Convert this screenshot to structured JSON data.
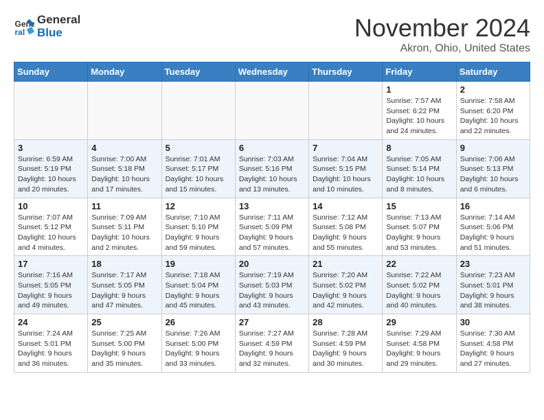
{
  "logo": {
    "line1": "General",
    "line2": "Blue"
  },
  "title": "November 2024",
  "location": "Akron, Ohio, United States",
  "weekdays": [
    "Sunday",
    "Monday",
    "Tuesday",
    "Wednesday",
    "Thursday",
    "Friday",
    "Saturday"
  ],
  "weeks": [
    [
      {
        "day": "",
        "info": ""
      },
      {
        "day": "",
        "info": ""
      },
      {
        "day": "",
        "info": ""
      },
      {
        "day": "",
        "info": ""
      },
      {
        "day": "",
        "info": ""
      },
      {
        "day": "1",
        "info": "Sunrise: 7:57 AM\nSunset: 6:22 PM\nDaylight: 10 hours and 24 minutes."
      },
      {
        "day": "2",
        "info": "Sunrise: 7:58 AM\nSunset: 6:20 PM\nDaylight: 10 hours and 22 minutes."
      }
    ],
    [
      {
        "day": "3",
        "info": "Sunrise: 6:59 AM\nSunset: 5:19 PM\nDaylight: 10 hours and 20 minutes."
      },
      {
        "day": "4",
        "info": "Sunrise: 7:00 AM\nSunset: 5:18 PM\nDaylight: 10 hours and 17 minutes."
      },
      {
        "day": "5",
        "info": "Sunrise: 7:01 AM\nSunset: 5:17 PM\nDaylight: 10 hours and 15 minutes."
      },
      {
        "day": "6",
        "info": "Sunrise: 7:03 AM\nSunset: 5:16 PM\nDaylight: 10 hours and 13 minutes."
      },
      {
        "day": "7",
        "info": "Sunrise: 7:04 AM\nSunset: 5:15 PM\nDaylight: 10 hours and 10 minutes."
      },
      {
        "day": "8",
        "info": "Sunrise: 7:05 AM\nSunset: 5:14 PM\nDaylight: 10 hours and 8 minutes."
      },
      {
        "day": "9",
        "info": "Sunrise: 7:06 AM\nSunset: 5:13 PM\nDaylight: 10 hours and 6 minutes."
      }
    ],
    [
      {
        "day": "10",
        "info": "Sunrise: 7:07 AM\nSunset: 5:12 PM\nDaylight: 10 hours and 4 minutes."
      },
      {
        "day": "11",
        "info": "Sunrise: 7:09 AM\nSunset: 5:11 PM\nDaylight: 10 hours and 2 minutes."
      },
      {
        "day": "12",
        "info": "Sunrise: 7:10 AM\nSunset: 5:10 PM\nDaylight: 9 hours and 59 minutes."
      },
      {
        "day": "13",
        "info": "Sunrise: 7:11 AM\nSunset: 5:09 PM\nDaylight: 9 hours and 57 minutes."
      },
      {
        "day": "14",
        "info": "Sunrise: 7:12 AM\nSunset: 5:08 PM\nDaylight: 9 hours and 55 minutes."
      },
      {
        "day": "15",
        "info": "Sunrise: 7:13 AM\nSunset: 5:07 PM\nDaylight: 9 hours and 53 minutes."
      },
      {
        "day": "16",
        "info": "Sunrise: 7:14 AM\nSunset: 5:06 PM\nDaylight: 9 hours and 51 minutes."
      }
    ],
    [
      {
        "day": "17",
        "info": "Sunrise: 7:16 AM\nSunset: 5:05 PM\nDaylight: 9 hours and 49 minutes."
      },
      {
        "day": "18",
        "info": "Sunrise: 7:17 AM\nSunset: 5:05 PM\nDaylight: 9 hours and 47 minutes."
      },
      {
        "day": "19",
        "info": "Sunrise: 7:18 AM\nSunset: 5:04 PM\nDaylight: 9 hours and 45 minutes."
      },
      {
        "day": "20",
        "info": "Sunrise: 7:19 AM\nSunset: 5:03 PM\nDaylight: 9 hours and 43 minutes."
      },
      {
        "day": "21",
        "info": "Sunrise: 7:20 AM\nSunset: 5:02 PM\nDaylight: 9 hours and 42 minutes."
      },
      {
        "day": "22",
        "info": "Sunrise: 7:22 AM\nSunset: 5:02 PM\nDaylight: 9 hours and 40 minutes."
      },
      {
        "day": "23",
        "info": "Sunrise: 7:23 AM\nSunset: 5:01 PM\nDaylight: 9 hours and 38 minutes."
      }
    ],
    [
      {
        "day": "24",
        "info": "Sunrise: 7:24 AM\nSunset: 5:01 PM\nDaylight: 9 hours and 36 minutes."
      },
      {
        "day": "25",
        "info": "Sunrise: 7:25 AM\nSunset: 5:00 PM\nDaylight: 9 hours and 35 minutes."
      },
      {
        "day": "26",
        "info": "Sunrise: 7:26 AM\nSunset: 5:00 PM\nDaylight: 9 hours and 33 minutes."
      },
      {
        "day": "27",
        "info": "Sunrise: 7:27 AM\nSunset: 4:59 PM\nDaylight: 9 hours and 32 minutes."
      },
      {
        "day": "28",
        "info": "Sunrise: 7:28 AM\nSunset: 4:59 PM\nDaylight: 9 hours and 30 minutes."
      },
      {
        "day": "29",
        "info": "Sunrise: 7:29 AM\nSunset: 4:58 PM\nDaylight: 9 hours and 29 minutes."
      },
      {
        "day": "30",
        "info": "Sunrise: 7:30 AM\nSunset: 4:58 PM\nDaylight: 9 hours and 27 minutes."
      }
    ]
  ]
}
